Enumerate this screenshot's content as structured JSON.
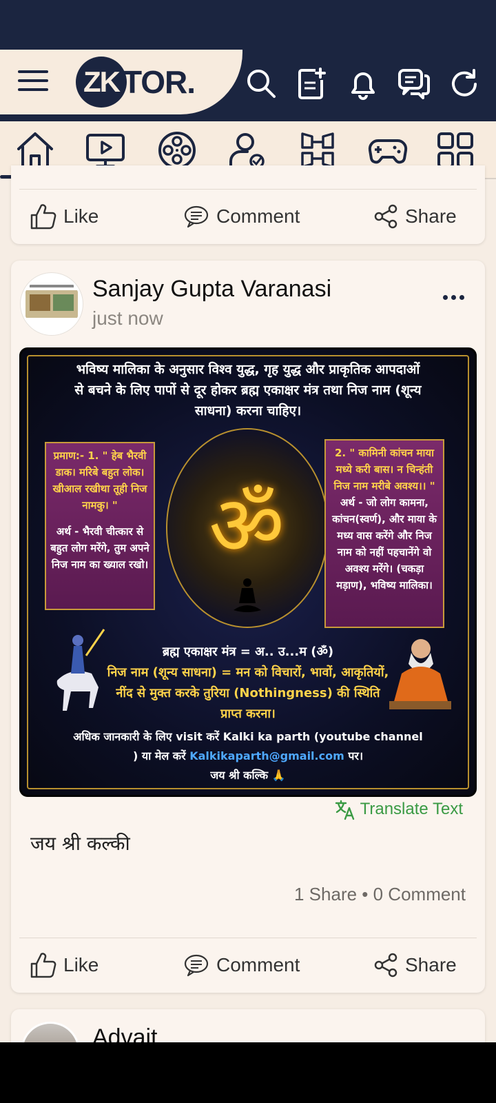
{
  "app": {
    "logo_mark": "ZK",
    "logo_rest": "TOR."
  },
  "header_icons": [
    "search-icon",
    "new-post-icon",
    "bell-icon",
    "chat-icon",
    "refresh-icon"
  ],
  "nav_icons": [
    "home-icon",
    "video-icon",
    "film-reel-icon",
    "user-verified-icon",
    "community-hands-icon",
    "gamepad-icon",
    "apps-grid-icon"
  ],
  "actions": {
    "like": "Like",
    "comment": "Comment",
    "share": "Share"
  },
  "post": {
    "author": "Sanjay Gupta Varanasi",
    "time": "just now",
    "poster": {
      "headline": "भविष्य मालिका के अनुसार विश्व युद्ध, गृह युद्ध और प्राकृतिक आपदाओं से बचने के लिए पापों से दूर होकर ब्रह्म एकाक्षर मंत्र तथा निज नाम (शून्य साधना) करना चाहिए।",
      "left_yellow": "प्रमाण:- 1. \" हेब भैरवी डाक। मरिबे बहुत लोक। खीआल रखीथा तूही निज नामकु। \"",
      "left_white": "अर्थ - भैरवी चीत्कार से बहुत लोग मरेंगे, तुम अपने निज नाम का ख्याल रखो।",
      "right_yellow": "2. \" कामिनी कांचन माया मध्ये करी बास। न चिन्हंती निज नाम मरीबे अवश्य।। \"",
      "right_white": "अर्थ - जो लोग कामना, कांचन(स्वर्ण), और माया के मध्य वास करेंगे और निज नाम को नहीं पहचानेंगे वो अवश्य मरेंगे। (चकड़ा मड़ाण), भविष्य मालिका।",
      "om": "ॐ",
      "mantra_line": "ब्रह्म एकाक्षर मंत्र = अ.. उ...म (ॐ)",
      "nij_naam": "निज नाम (शून्य साधना) = मन को विचारों, भावों, आकृतियों, नींद से मुक्त करके तुरिया (Nothingness) की स्थिति प्राप्त करना।",
      "footer_1": "अधिक जानकारी के लिए visit करें Kalki ka parth (youtube channel ) या मेल करें",
      "email": "Kalkikaparth@gmail.com",
      "footer_2": "पर।",
      "footer_3": "जय श्री कल्कि 🙏"
    },
    "translate_label": "Translate Text",
    "text": "जय श्री कल्की",
    "stats": "1 Share • 0 Comment"
  },
  "next_post": {
    "author": "Advait"
  },
  "colors": {
    "navy": "#1b2540",
    "cream": "#f7ebde",
    "card": "#fbf4ee",
    "translate_green": "#3a9a44"
  }
}
